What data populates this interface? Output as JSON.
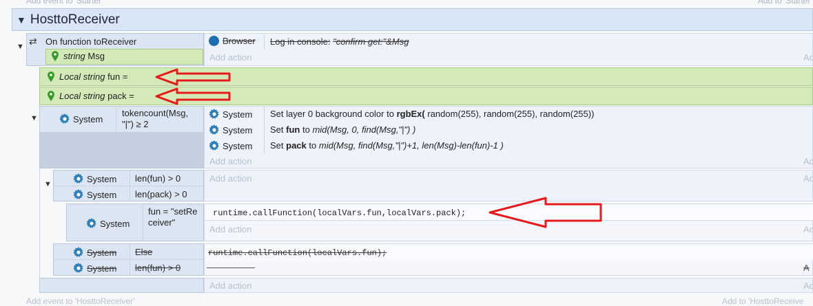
{
  "top_hints": {
    "left": "Add event to 'Starter'",
    "right": "Add to 'Starter'"
  },
  "group": {
    "title": "HosttoReceiver",
    "collapse_glyph": "▼"
  },
  "function_event": {
    "label_prefix": "On function",
    "name": "toReceiver",
    "param_type": "string",
    "param_name": "Msg",
    "action_object": "Browser",
    "action_text_prefix": "Log in console:",
    "action_text_value": "\"confirm get:\"&Msg",
    "add_action": "Add action",
    "add_action_short": "Ad"
  },
  "locals": [
    {
      "prefix": "Local string",
      "name": "fun",
      "suffix": "="
    },
    {
      "prefix": "Local string",
      "name": "pack",
      "suffix": "="
    }
  ],
  "event1": {
    "object": "System",
    "condition": "tokencount(Msg, \"|\") ≥ 2",
    "actions": [
      {
        "object": "System",
        "pre": "Set layer 0 background color to",
        "bold": "rgbEx(",
        "post": "random(255), random(255), random(255))"
      },
      {
        "object": "System",
        "pre": "Set",
        "bold": "fun",
        "mid": "to",
        "expr": "mid(Msg, 0, find(Msg,\"|\") )"
      },
      {
        "object": "System",
        "pre": "Set",
        "bold": "pack",
        "mid": "to",
        "expr": "mid(Msg, find(Msg,\"|\")+1, len(Msg)-len(fun)-1 )"
      }
    ],
    "add_action": "Add action",
    "add_action_short": "Ad"
  },
  "event2": {
    "conditions": [
      {
        "object": "System",
        "text": "len(fun) > 0"
      },
      {
        "object": "System",
        "text": "len(pack) > 0"
      }
    ],
    "add_action": "Add action",
    "add_action_short": "Ad"
  },
  "event3": {
    "object": "System",
    "condition": "fun = \"setReceiver\"",
    "script": "runtime.callFunction(localVars.fun,localVars.pack);",
    "add_action": "Add action",
    "add_action_short": "Ad"
  },
  "event4": {
    "conditions": [
      {
        "object": "System",
        "text": "Else"
      },
      {
        "object": "System",
        "text": "len(fun) > 0"
      }
    ],
    "script": "runtime.callFunction(localVars.fun);",
    "add_action_short": "A"
  },
  "bottom": {
    "add_action": "Add action",
    "add_action_short": "Ad",
    "add_event": "Add event to 'HosttoReceiver'",
    "add_to": "Add to 'HosttoReceive"
  },
  "colors": {
    "accent": "#2e8bc8",
    "green": "#d3eab8",
    "arrow": "#e8191b"
  }
}
